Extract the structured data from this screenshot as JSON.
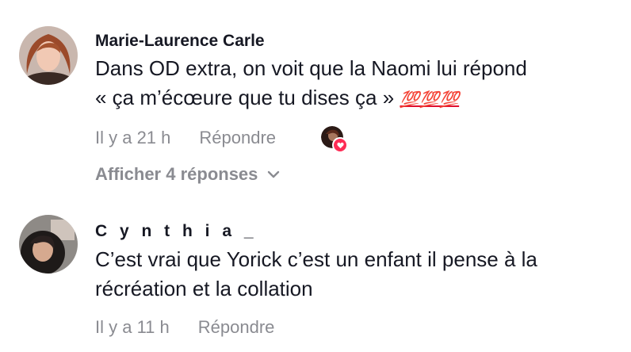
{
  "comments": [
    {
      "username": "Marie-Laurence Carle",
      "text_line1": "Dans OD extra, on voit que la Naomi lui répond",
      "text_line2": "« ça m’écœure que tu dises ça »",
      "emoji": "💯💯💯",
      "time": "Il y a 21 h",
      "reply_label": "Répondre",
      "show_replies_label": "Afficher 4 réponses"
    },
    {
      "username": "C y n t h i a _",
      "text_line1": "C’est vrai que Yorick c’est un enfant il pense à la",
      "text_line2": "récréation et la collation",
      "time": "Il y a 11 h",
      "reply_label": "Répondre"
    }
  ],
  "colors": {
    "primary_text": "#161823",
    "secondary_text": "#8a8b91",
    "like_badge": "#fe2c55"
  }
}
